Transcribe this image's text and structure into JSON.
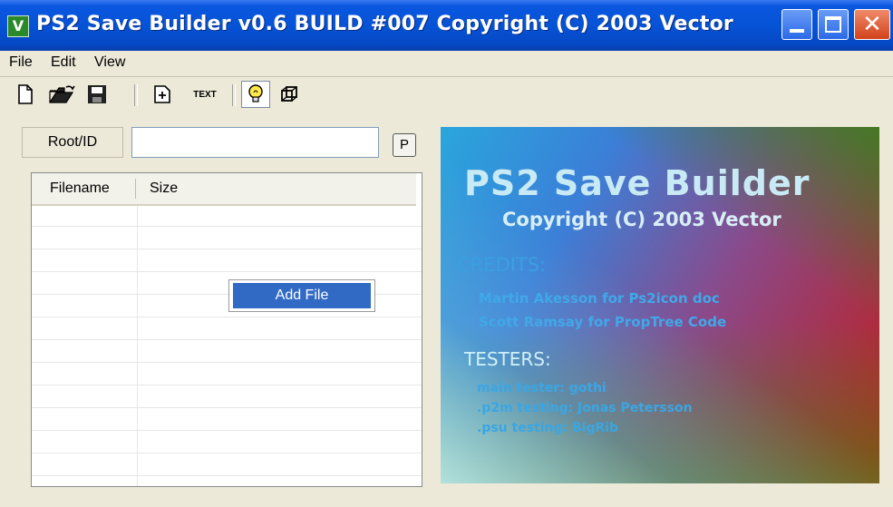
{
  "window": {
    "title": "PS2 Save Builder v0.6 BUILD #007 Copyright (C) 2003 Vector",
    "icon_letter": "V"
  },
  "menu": [
    "File",
    "Edit",
    "View"
  ],
  "toolbar": {
    "buttons": [
      "new-icon",
      "open-folder-icon",
      "save-icon",
      "add-file-icon",
      "text-icon",
      "lightbulb-icon",
      "cube-icon"
    ],
    "text_label": "TEXT"
  },
  "root": {
    "label": "Root/ID",
    "value": "",
    "p_button": "P"
  },
  "filelist": {
    "columns": [
      "Filename",
      "Size"
    ],
    "rows": []
  },
  "context_menu": {
    "items": [
      "Add File"
    ]
  },
  "splash": {
    "title": "PS2 Save Builder",
    "copyright": "Copyright (C) 2003 Vector",
    "credits_heading": "CREDITS:",
    "credits": [
      "Martin Akesson for Ps2icon doc",
      "Scott Ramsay for PropTree Code"
    ],
    "testers_heading": "TESTERS:",
    "testers": [
      "main tester: gothi",
      ".p2m testing: Jonas Petersson",
      ".psu testing: BigRib"
    ]
  },
  "colors": {
    "titlebar": "#0653d6",
    "highlight": "#316ac5",
    "window_bg": "#ece9d8"
  }
}
